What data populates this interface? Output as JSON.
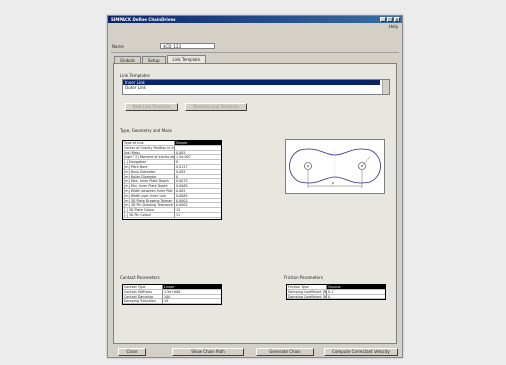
{
  "window": {
    "title": "SIMPACK Define ChainDrives",
    "menu_help": "Help",
    "minimize": "_",
    "maximize": "□",
    "close": "x"
  },
  "name_field": {
    "label": "Name",
    "value": "$CD_123"
  },
  "tabs": [
    {
      "label": "Globals"
    },
    {
      "label": "Setup"
    },
    {
      "label": "Link Template"
    }
  ],
  "link_templates": {
    "label": "Link Templates",
    "items": [
      "Inner Link",
      "Outer Link"
    ],
    "new_button": "New Link Template",
    "remove_button": "Remove Link Template"
  },
  "type_geometry": {
    "label": "Type, Geometry and Mass",
    "rows": [
      {
        "k": "Type of Link",
        "v": "Simple"
      },
      {
        "k": "Center of Gravity Position in d",
        "v": ""
      },
      {
        "k": "[kg] Mass",
        "v": "0.005"
      },
      {
        "k": "[kgm^2] Moment of Inertia abo",
        "v": "1.5e-007"
      },
      {
        "k": "[-] Elongation",
        "v": "0"
      },
      {
        "k": "[m] Pitch Bore",
        "v": "0.0127"
      },
      {
        "k": "[m] Bush Diameter",
        "v": "0.005"
      },
      {
        "k": "[m] Roller Diameter",
        "v": "0"
      },
      {
        "k": "[m] Max. Inner Plate Depth",
        "v": "0.0075"
      },
      {
        "k": "[m] Min. Inner Plate Depth",
        "v": "0.0065"
      },
      {
        "k": "[m] Width between Inner Plat",
        "v": "0.005"
      },
      {
        "k": "[m] Width over Inner Link",
        "v": "0.0085"
      },
      {
        "k": "[m] 3D Plate Drawing Toleran",
        "v": "0.0002"
      },
      {
        "k": "[m] 3D Pin Drawing Tolerance",
        "v": "0.0002"
      },
      {
        "k": "[-] 3D Plate Colour",
        "v": "15"
      },
      {
        "k": "[-] 3D Pin Colour",
        "v": "11"
      }
    ]
  },
  "diagram": {
    "dim_label": "p"
  },
  "contact_parameters": {
    "label": "Contact Parameters",
    "rows": [
      {
        "k": "Contact Type",
        "v": "Linear"
      },
      {
        "k": "Contact Stiffness",
        "v": "1.5e+006"
      },
      {
        "k": "Contact Damping",
        "v": "100"
      },
      {
        "k": "Damping Transition",
        "v": "10"
      }
    ]
  },
  "friction_parameters": {
    "label": "Friction Parameters",
    "rows": [
      {
        "k": "Friction Type",
        "v": "Viscous"
      },
      {
        "k": "Damping Coefficient [N/s/m]",
        "v": "0.1"
      },
      {
        "k": "Damping Coefficient [Nms/rad]",
        "v": "0"
      }
    ]
  },
  "bottom_buttons": {
    "close": "Close",
    "show_chain_path": "Show Chain Path",
    "generate_chain": "Generate Chain",
    "compute_velocity": "Compute Correctant Velocity"
  },
  "colors": {
    "title_bg": "#0a246a",
    "selection": "#0a246a",
    "diagram_line": "#2a2a8a"
  }
}
